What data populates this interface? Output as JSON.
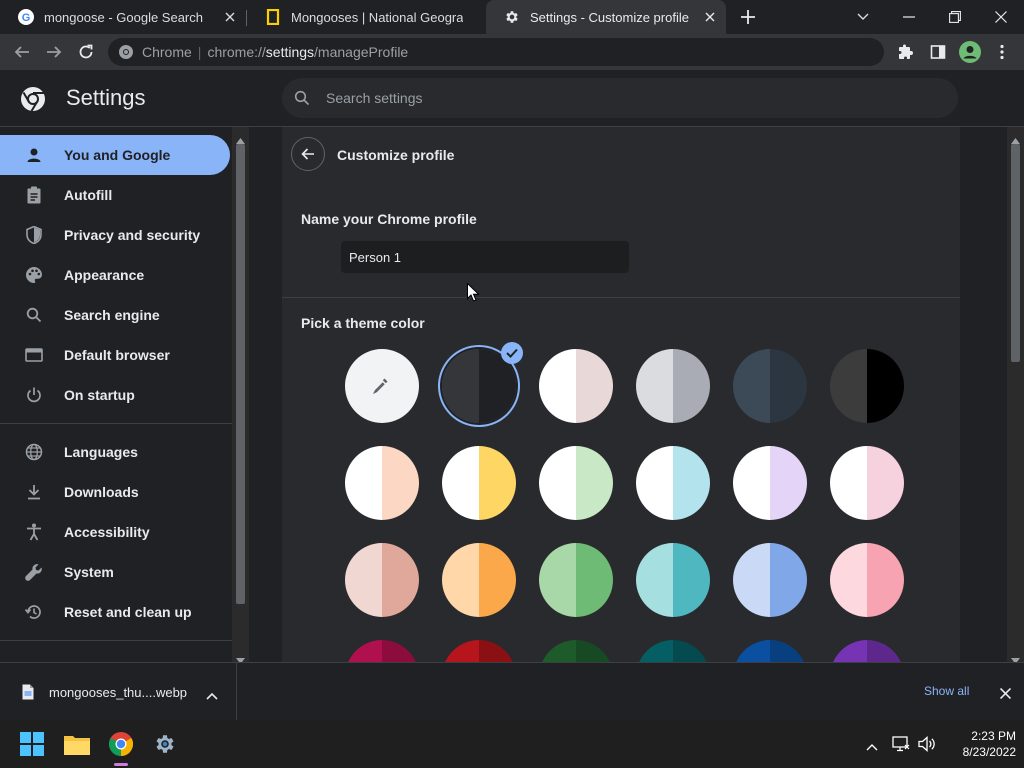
{
  "browser": {
    "tabs": [
      {
        "title": "mongoose - Google Search",
        "favicon": "google-icon"
      },
      {
        "title": "Mongooses | National Geographic",
        "favicon": "natgeo-icon"
      },
      {
        "title": "Settings - Customize profile",
        "favicon": "settings-gear-icon",
        "active": true
      }
    ],
    "url_scheme_label": "Chrome",
    "url_prefix": "chrome://",
    "url_host": "settings",
    "url_path": "/manageProfile"
  },
  "settings": {
    "title": "Settings",
    "search_placeholder": "Search settings",
    "nav": [
      {
        "label": "You and Google",
        "icon": "person-icon",
        "selected": true
      },
      {
        "label": "Autofill",
        "icon": "clipboard-icon"
      },
      {
        "label": "Privacy and security",
        "icon": "shield-icon"
      },
      {
        "label": "Appearance",
        "icon": "palette-icon"
      },
      {
        "label": "Search engine",
        "icon": "search-icon"
      },
      {
        "label": "Default browser",
        "icon": "browser-window-icon"
      },
      {
        "label": "On startup",
        "icon": "power-icon"
      },
      {
        "label": "Languages",
        "icon": "globe-icon"
      },
      {
        "label": "Downloads",
        "icon": "download-icon"
      },
      {
        "label": "Accessibility",
        "icon": "accessibility-icon"
      },
      {
        "label": "System",
        "icon": "wrench-icon"
      },
      {
        "label": "Reset and clean up",
        "icon": "restore-icon"
      }
    ],
    "page_title": "Customize profile",
    "name_label": "Name your Chrome profile",
    "name_value": "Person 1",
    "theme_label": "Pick a theme color",
    "theme_colors": [
      [
        "#f1f3f4",
        "#f1f3f4"
      ],
      [
        "#35363a",
        "#202124"
      ],
      [
        "#ffffff",
        "#e8d8d8"
      ],
      [
        "#dadce0",
        "#a9acb4"
      ],
      [
        "#3c4a57",
        "#2b3641"
      ],
      [
        "#3c3c3c",
        "#000000"
      ],
      [
        "#ffffff",
        "#fcd7c4"
      ],
      [
        "#ffffff",
        "#fdd663"
      ],
      [
        "#ffffff",
        "#c9e8c6"
      ],
      [
        "#ffffff",
        "#b3e4ee"
      ],
      [
        "#ffffff",
        "#e4d4f7"
      ],
      [
        "#ffffff",
        "#f6d1de"
      ],
      [
        "#f1d7d1",
        "#e0a89a"
      ],
      [
        "#ffd7a8",
        "#fba84a"
      ],
      [
        "#a8d8a8",
        "#6dbb74"
      ],
      [
        "#a6dfdf",
        "#4fb7bf"
      ],
      [
        "#cad9f5",
        "#80a8e8"
      ],
      [
        "#fdd8de",
        "#f7a3b1"
      ],
      [
        "#b0104e",
        "#8c0c3e"
      ],
      [
        "#b5151b",
        "#8a1013"
      ],
      [
        "#1e5b2a",
        "#174a22"
      ],
      [
        "#055e63",
        "#044a4e"
      ],
      [
        "#0b4fa0",
        "#08407f"
      ],
      [
        "#7633b4",
        "#5d278c"
      ]
    ],
    "selected_color_index": 1
  },
  "download_shelf": {
    "file_name": "mongooses_thu....webp",
    "show_all": "Show all"
  },
  "taskbar": {
    "time": "2:23 PM",
    "date": "8/23/2022"
  }
}
